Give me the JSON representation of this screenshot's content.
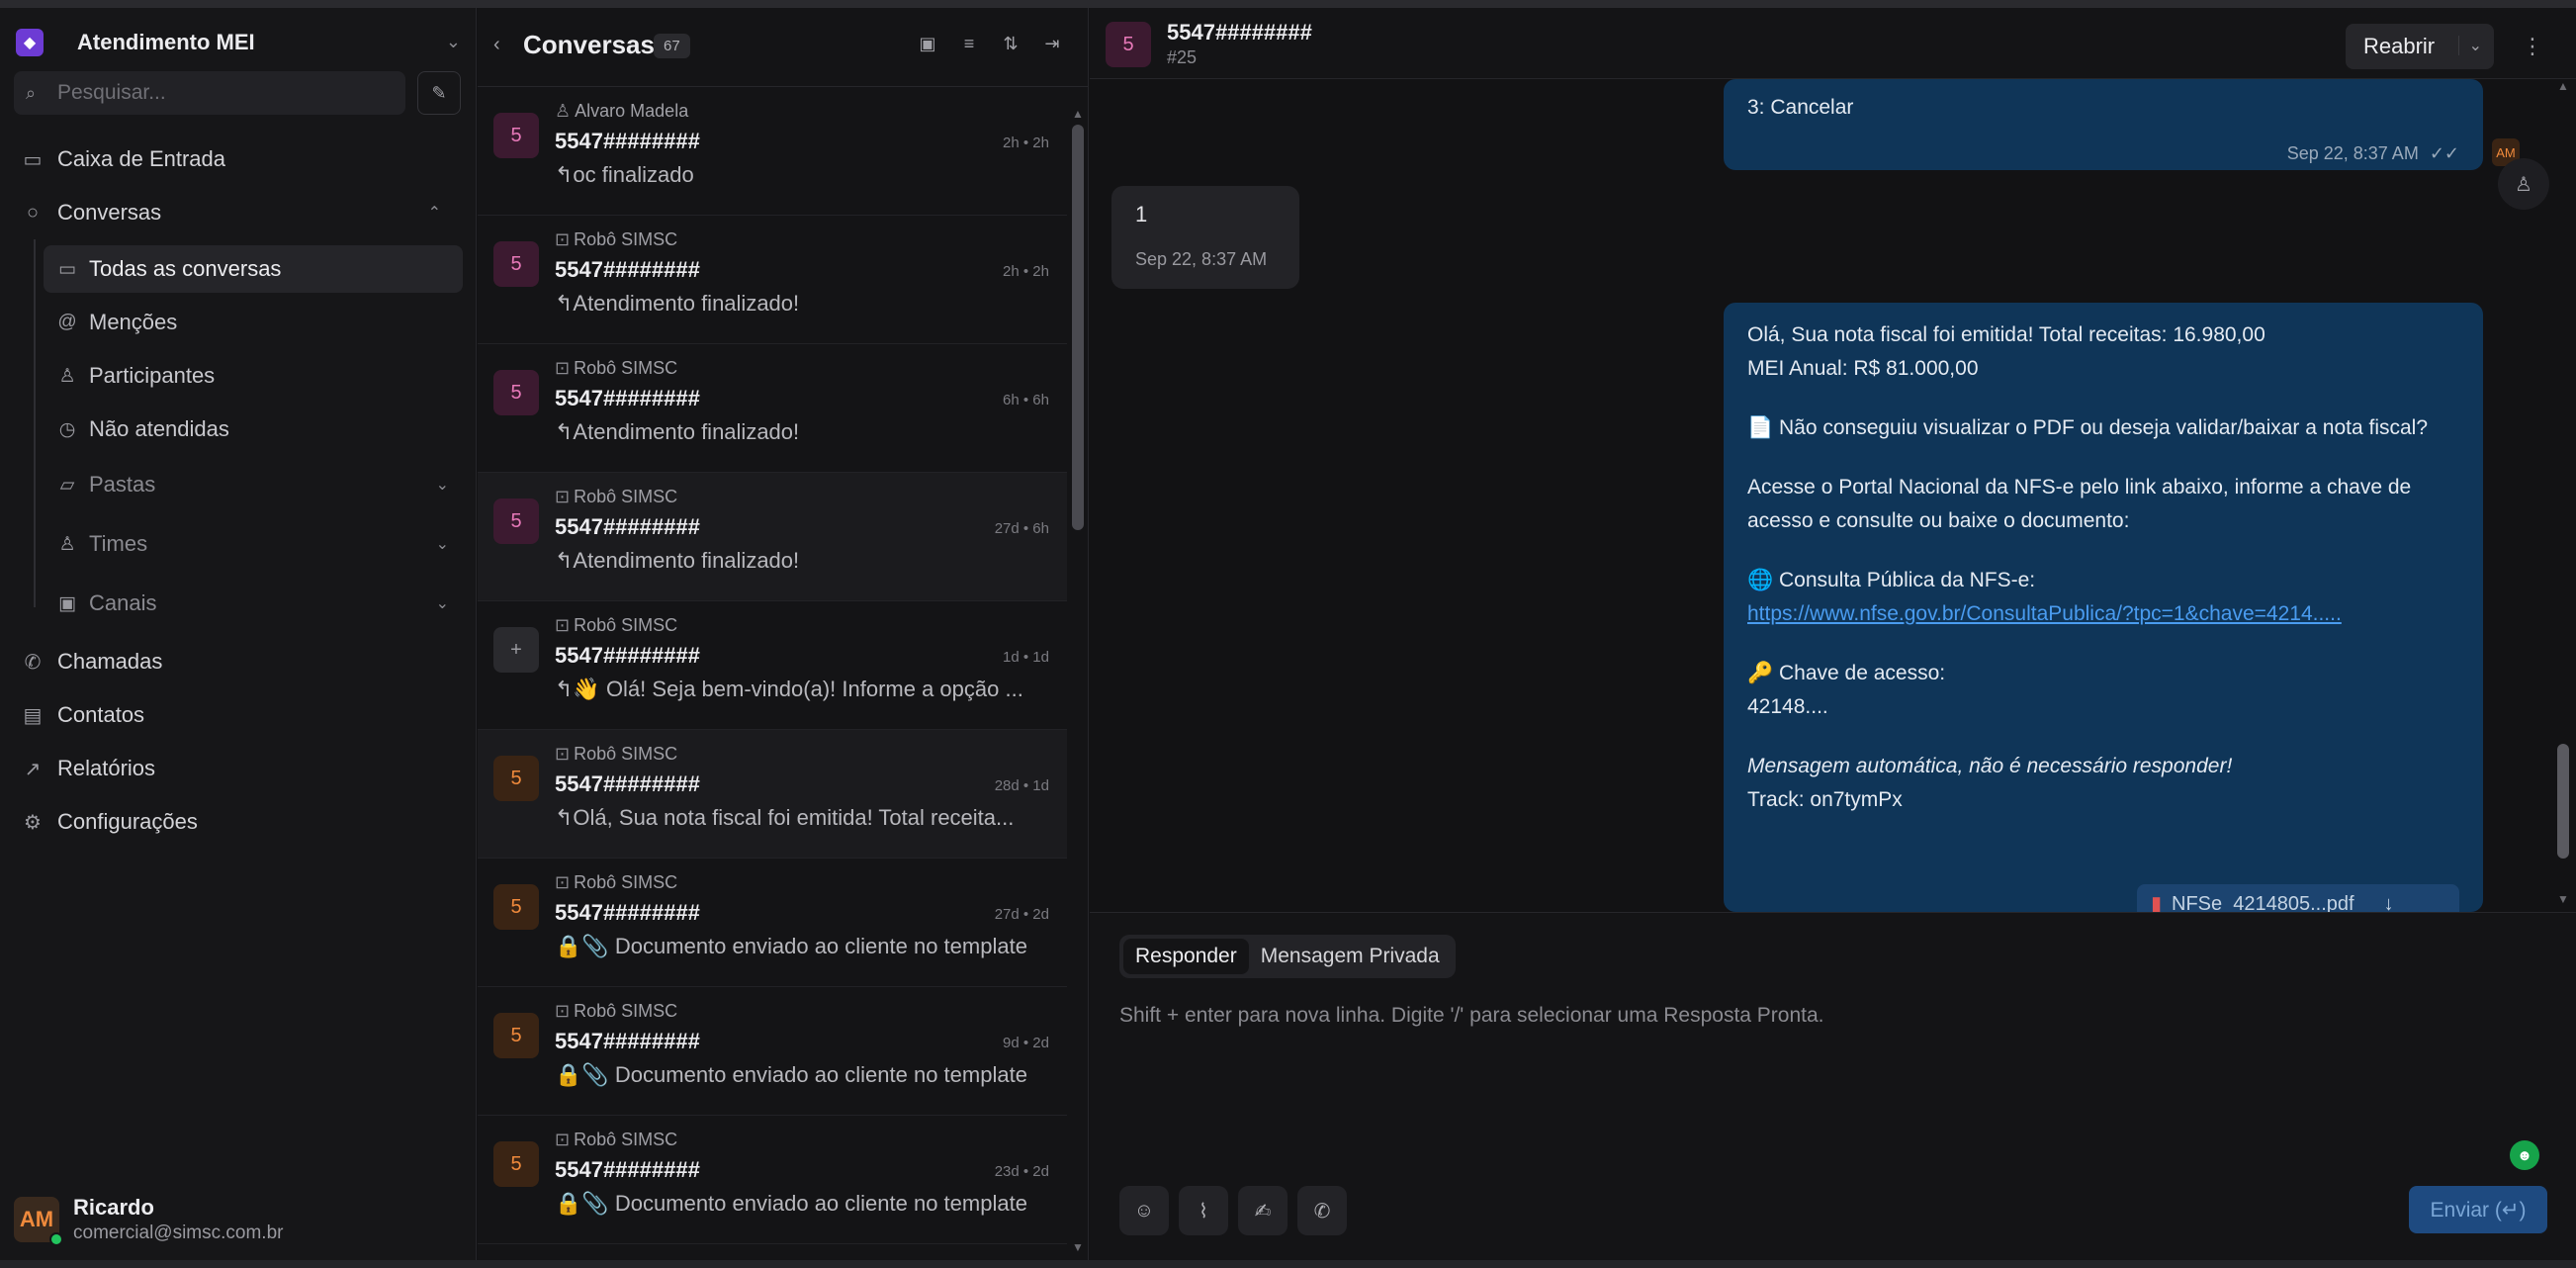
{
  "sidebar": {
    "inbox_name": "Atendimento MEI",
    "search_placeholder": "Pesquisar...",
    "nav": {
      "inbox": "Caixa de Entrada",
      "conversations": "Conversas",
      "calls": "Chamadas",
      "contacts": "Contatos",
      "reports": "Relatórios",
      "settings": "Configurações"
    },
    "sub": {
      "all": "Todas as conversas",
      "mentions": "Menções",
      "participants": "Participantes",
      "unattended": "Não atendidas",
      "folders": "Pastas",
      "teams": "Times",
      "channels": "Canais"
    },
    "user": {
      "initials": "AM",
      "name": "Ricardo",
      "email": "comercial@simsc.com.br"
    }
  },
  "list": {
    "title": "Conversas",
    "count": "67",
    "items": [
      {
        "avatar": "5",
        "agent": "Alvaro Madela",
        "phone": "5547########",
        "time": "2h • 2h",
        "msg": "↰oc finalizado"
      },
      {
        "avatar": "5",
        "agent": "Robô SIMSC",
        "phone": "5547########",
        "time": "2h • 2h",
        "msg": "↰Atendimento finalizado!"
      },
      {
        "avatar": "5",
        "agent": "Robô SIMSC",
        "phone": "5547########",
        "time": "6h • 6h",
        "msg": "↰Atendimento finalizado!"
      },
      {
        "avatar": "5",
        "agent": "Robô SIMSC",
        "phone": "5547########",
        "time": "27d • 6h",
        "msg": "↰Atendimento finalizado!"
      },
      {
        "avatar": "+",
        "agent": "Robô SIMSC",
        "phone": "5547########",
        "time": "1d • 1d",
        "msg": "↰👋 Olá! Seja bem-vindo(a)! Informe a opção ..."
      },
      {
        "avatar": "5",
        "agent": "Robô SIMSC",
        "phone": "5547########",
        "time": "28d • 1d",
        "msg": "↰Olá, Sua nota fiscal foi emitida! Total receita..."
      },
      {
        "avatar": "5",
        "agent": "Robô SIMSC",
        "phone": "5547########",
        "time": "27d • 2d",
        "msg": "🔒📎 Documento enviado ao cliente no template"
      },
      {
        "avatar": "5",
        "agent": "Robô SIMSC",
        "phone": "5547########",
        "time": "9d • 2d",
        "msg": "🔒📎 Documento enviado ao cliente no template"
      },
      {
        "avatar": "5",
        "agent": "Robô SIMSC",
        "phone": "5547########",
        "time": "23d • 2d",
        "msg": "🔒📎 Documento enviado ao cliente no template"
      }
    ]
  },
  "chat": {
    "avatar": "5",
    "phone": "5547########",
    "id": "#25",
    "reopen_label": "Reabrir",
    "msg1_text": "3: Cancelar",
    "msg1_meta": "Sep 22, 8:37 AM",
    "msg2_text": "1",
    "msg2_meta": "Sep 22, 8:37 AM",
    "agent_initials": "AM",
    "msg3": {
      "line1": "Olá, Sua nota fiscal foi emitida! Total receitas: 16.980,00",
      "line2": "MEI Anual: R$ 81.000,00",
      "para2": "📄 Não conseguiu visualizar o PDF ou deseja validar/baixar a nota fiscal?",
      "para3": "Acesse o Portal Nacional da NFS-e pelo link abaixo, informe a chave de acesso e consulte ou baixe o documento:",
      "portal_label": "🌐 Consulta Pública da NFS-e:",
      "portal_link": "https://www.nfse.gov.br/ConsultaPublica/?tpc=1&chave=4214.....",
      "key_label": "🔑 Chave de acesso:",
      "key_value": "42148....",
      "auto_note": "Mensagem automática, não é necessário responder!",
      "track": "Track: on7tymPx",
      "attachment": "NFSe_4214805...pdf"
    }
  },
  "composer": {
    "tab_reply": "Responder",
    "tab_private": "Mensagem Privada",
    "placeholder": "Shift + enter para nova linha. Digite '/' para selecionar uma Resposta Pronta.",
    "send_label": "Enviar (↵)"
  }
}
